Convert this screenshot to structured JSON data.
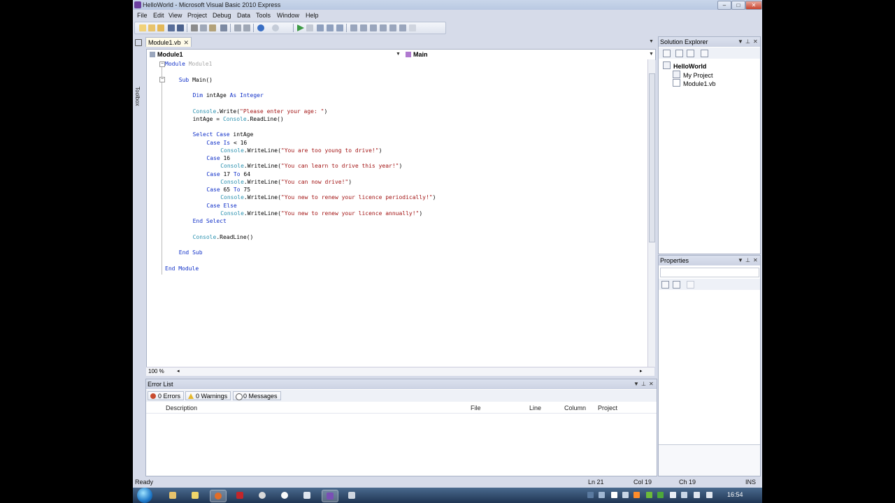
{
  "window": {
    "title": "HelloWorld - Microsoft Visual Basic 2010 Express",
    "controls": {
      "minimize": "–",
      "maximize": "□",
      "close": "✕"
    }
  },
  "menu": [
    "File",
    "Edit",
    "View",
    "Project",
    "Debug",
    "Data",
    "Tools",
    "Window",
    "Help"
  ],
  "toolbox": {
    "label": "Toolbox"
  },
  "editor": {
    "tab_label": "Module1.vb",
    "tab_close": "✕",
    "nav_left": "Module1",
    "nav_right": "Main",
    "zoom": "100 %",
    "code_lines": [
      {
        "parts": [
          {
            "t": "Module",
            "c": "kw"
          },
          {
            "t": " Module1",
            "c": "dim"
          }
        ],
        "indent": 0
      },
      {
        "parts": [],
        "indent": 0
      },
      {
        "parts": [
          {
            "t": "Sub",
            "c": "kw"
          },
          {
            "t": " Main()",
            "c": ""
          }
        ],
        "indent": 1
      },
      {
        "parts": [],
        "indent": 0
      },
      {
        "parts": [
          {
            "t": "Dim",
            "c": "kw"
          },
          {
            "t": " intAge ",
            "c": ""
          },
          {
            "t": "As",
            "c": "kw"
          },
          {
            "t": " ",
            "c": ""
          },
          {
            "t": "Integer",
            "c": "kw"
          }
        ],
        "indent": 2
      },
      {
        "parts": [],
        "indent": 0
      },
      {
        "parts": [
          {
            "t": "Console",
            "c": "cls"
          },
          {
            "t": ".Write(",
            "c": ""
          },
          {
            "t": "\"Please enter your age: \"",
            "c": "str"
          },
          {
            "t": ")",
            "c": ""
          }
        ],
        "indent": 2
      },
      {
        "parts": [
          {
            "t": "intAge = ",
            "c": ""
          },
          {
            "t": "Console",
            "c": "cls"
          },
          {
            "t": ".ReadLine()",
            "c": ""
          }
        ],
        "indent": 2
      },
      {
        "parts": [],
        "indent": 0
      },
      {
        "parts": [
          {
            "t": "Select",
            "c": "kw"
          },
          {
            "t": " ",
            "c": ""
          },
          {
            "t": "Case",
            "c": "kw"
          },
          {
            "t": " intAge",
            "c": ""
          }
        ],
        "indent": 2
      },
      {
        "parts": [
          {
            "t": "Case",
            "c": "kw"
          },
          {
            "t": " ",
            "c": ""
          },
          {
            "t": "Is",
            "c": "kw"
          },
          {
            "t": " < 16",
            "c": ""
          }
        ],
        "indent": 3
      },
      {
        "parts": [
          {
            "t": "Console",
            "c": "cls"
          },
          {
            "t": ".WriteLine(",
            "c": ""
          },
          {
            "t": "\"You are too young to drive!\"",
            "c": "str"
          },
          {
            "t": ")",
            "c": ""
          }
        ],
        "indent": 4
      },
      {
        "parts": [
          {
            "t": "Case",
            "c": "kw"
          },
          {
            "t": " 16",
            "c": ""
          }
        ],
        "indent": 3
      },
      {
        "parts": [
          {
            "t": "Console",
            "c": "cls"
          },
          {
            "t": ".WriteLine(",
            "c": ""
          },
          {
            "t": "\"You can learn to drive this year!\"",
            "c": "str"
          },
          {
            "t": ")",
            "c": ""
          }
        ],
        "indent": 4
      },
      {
        "parts": [
          {
            "t": "Case",
            "c": "kw"
          },
          {
            "t": " 17 ",
            "c": ""
          },
          {
            "t": "To",
            "c": "kw"
          },
          {
            "t": " 64",
            "c": ""
          }
        ],
        "indent": 3
      },
      {
        "parts": [
          {
            "t": "Console",
            "c": "cls"
          },
          {
            "t": ".WriteLine(",
            "c": ""
          },
          {
            "t": "\"You can now drive!\"",
            "c": "str"
          },
          {
            "t": ")",
            "c": ""
          }
        ],
        "indent": 4
      },
      {
        "parts": [
          {
            "t": "Case",
            "c": "kw"
          },
          {
            "t": " 65 ",
            "c": ""
          },
          {
            "t": "To",
            "c": "kw"
          },
          {
            "t": " 75",
            "c": ""
          }
        ],
        "indent": 3
      },
      {
        "parts": [
          {
            "t": "Console",
            "c": "cls"
          },
          {
            "t": ".WriteLine(",
            "c": ""
          },
          {
            "t": "\"You new to renew your licence periodically!\"",
            "c": "str"
          },
          {
            "t": ")",
            "c": ""
          }
        ],
        "indent": 4
      },
      {
        "parts": [
          {
            "t": "Case",
            "c": "kw"
          },
          {
            "t": " ",
            "c": ""
          },
          {
            "t": "Else",
            "c": "kw"
          }
        ],
        "indent": 3
      },
      {
        "parts": [
          {
            "t": "Console",
            "c": "cls"
          },
          {
            "t": ".WriteLine(",
            "c": ""
          },
          {
            "t": "\"You new to renew your licence annually!\"",
            "c": "str"
          },
          {
            "t": ")",
            "c": ""
          }
        ],
        "indent": 4
      },
      {
        "parts": [
          {
            "t": "End",
            "c": "kw"
          },
          {
            "t": " ",
            "c": ""
          },
          {
            "t": "Select",
            "c": "kw"
          }
        ],
        "indent": 2
      },
      {
        "parts": [],
        "indent": 0
      },
      {
        "parts": [
          {
            "t": "Console",
            "c": "cls"
          },
          {
            "t": ".ReadLine()",
            "c": ""
          }
        ],
        "indent": 2
      },
      {
        "parts": [],
        "indent": 0
      },
      {
        "parts": [
          {
            "t": "End",
            "c": "kw"
          },
          {
            "t": " ",
            "c": ""
          },
          {
            "t": "Sub",
            "c": "kw"
          }
        ],
        "indent": 1
      },
      {
        "parts": [],
        "indent": 0
      },
      {
        "parts": [
          {
            "t": "End",
            "c": "kw"
          },
          {
            "t": " ",
            "c": ""
          },
          {
            "t": "Module",
            "c": "kw"
          }
        ],
        "indent": 0
      }
    ]
  },
  "error_list": {
    "title": "Error List",
    "filters": {
      "errors": "0 Errors",
      "warnings": "0 Warnings",
      "messages": "0 Messages"
    },
    "columns": {
      "description": "Description",
      "file": "File",
      "line": "Line",
      "column": "Column",
      "project": "Project"
    }
  },
  "solution_explorer": {
    "title": "Solution Explorer",
    "project": "HelloWorld",
    "items": [
      "My Project",
      "Module1.vb"
    ]
  },
  "properties": {
    "title": "Properties"
  },
  "status": {
    "ready": "Ready",
    "ln": "Ln 21",
    "col": "Col 19",
    "ch": "Ch 19",
    "ins": "INS"
  },
  "taskbar": {
    "clock": "16:54"
  }
}
